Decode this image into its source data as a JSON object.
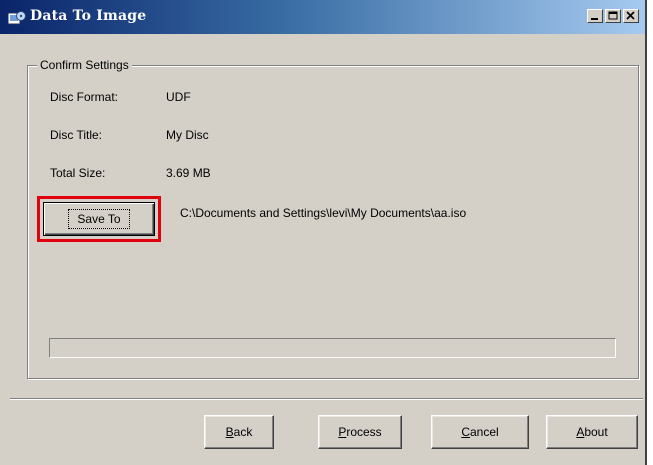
{
  "window": {
    "title": "Data To Image",
    "icon": "disc-image-app-icon",
    "caption_buttons": [
      "minimize-icon",
      "maximize-icon",
      "close-icon"
    ]
  },
  "group": {
    "label": "Confirm Settings",
    "rows": [
      {
        "label": "Disc Format:",
        "value": "UDF"
      },
      {
        "label": "Disc Title:",
        "value": "My Disc"
      },
      {
        "label": "Total Size:",
        "value": "3.69 MB"
      }
    ],
    "save_to_label": "Save To",
    "save_path": "C:\\Documents and Settings\\levi\\My Documents\\aa.iso",
    "progress_fraction": 0
  },
  "footer": {
    "back": {
      "mnemonic": "B",
      "rest": "ack"
    },
    "process": {
      "mnemonic": "P",
      "rest": "rocess"
    },
    "cancel": {
      "mnemonic": "C",
      "rest": "ancel"
    },
    "about": {
      "mnemonic": "A",
      "rest": "bout"
    }
  },
  "colors": {
    "highlight_box": "#e0000e",
    "titlebar_start": "#0a246a",
    "titlebar_end": "#a6caf0",
    "face": "#d4d0c8"
  }
}
